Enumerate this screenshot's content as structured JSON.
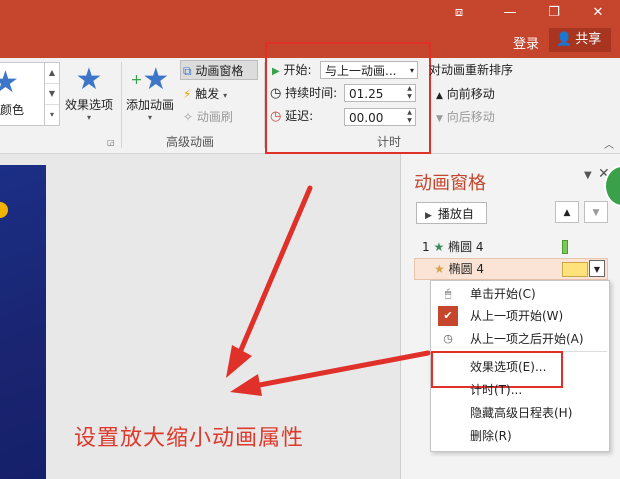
{
  "titlebar": {
    "icons": [
      "ribbon-display-icon",
      "minimize-icon",
      "restore-icon",
      "close-icon"
    ],
    "icon_glyphs": [
      "⧈",
      "—",
      "❐",
      "✕"
    ],
    "login": "登录",
    "share": "共享",
    "color": "#c6452d"
  },
  "ribbon": {
    "gallery_label": "颜色",
    "effect_options": "效果选项",
    "add_animation": "添加动画",
    "animation_pane": "动画窗格",
    "trigger": "触发",
    "animation_painter": "动画刷",
    "advanced_group": "高级动画",
    "start_label": "开始:",
    "start_value": "与上一动画...",
    "duration_label": "持续时间:",
    "duration_value": "01.25",
    "delay_label": "延迟:",
    "delay_value": "00.00",
    "timing_group": "计时",
    "reorder_title": "对动画重新排序",
    "move_earlier": "向前移动",
    "move_later": "向后移动"
  },
  "slide": {
    "caption": "设置放大缩小动画属性"
  },
  "pane": {
    "title": "动画窗格",
    "play": "播放自",
    "items": [
      {
        "number": "1",
        "name": "椭圆 4"
      },
      {
        "number": "",
        "name": "椭圆 4"
      }
    ]
  },
  "menu": {
    "items": [
      "单击开始(C)",
      "从上一项开始(W)",
      "从上一项之后开始(A)",
      "效果选项(E)...",
      "计时(T)...",
      "隐藏高级日程表(H)",
      "删除(R)"
    ]
  },
  "colors": {
    "accent": "#c6452d",
    "highlight": "#e0302a",
    "star": "#3d75c8"
  }
}
